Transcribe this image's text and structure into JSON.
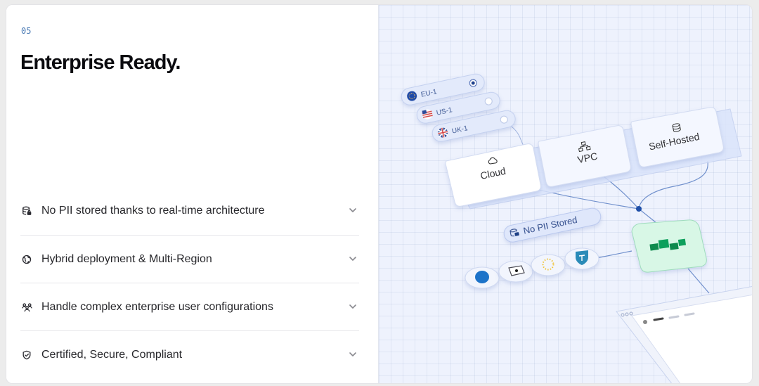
{
  "section": {
    "number": "05",
    "title": "Enterprise Ready."
  },
  "features": [
    {
      "label": "No PII stored thanks to real-time architecture",
      "icon": "database-lock-icon"
    },
    {
      "label": "Hybrid deployment & Multi-Region",
      "icon": "globe-icon"
    },
    {
      "label": "Handle complex enterprise user configurations",
      "icon": "users-icon"
    },
    {
      "label": "Certified, Secure, Compliant",
      "icon": "shield-check-icon"
    }
  ],
  "illustration": {
    "regions": [
      {
        "label": "EU-1",
        "selected": true,
        "flag": "eu-flag-icon"
      },
      {
        "label": "US-1",
        "selected": false,
        "flag": "us-flag-icon"
      },
      {
        "label": "UK-1",
        "selected": false,
        "flag": "uk-flag-icon"
      }
    ],
    "deployments": {
      "cloud": "Cloud",
      "vpc": "VPC",
      "self_hosted": "Self-Hosted"
    },
    "pii_badge": "No PII Stored",
    "colors": {
      "accent": "#1f5fc4",
      "brand_green": "#10a05b",
      "brand_tile": "#d8f7e6"
    }
  }
}
